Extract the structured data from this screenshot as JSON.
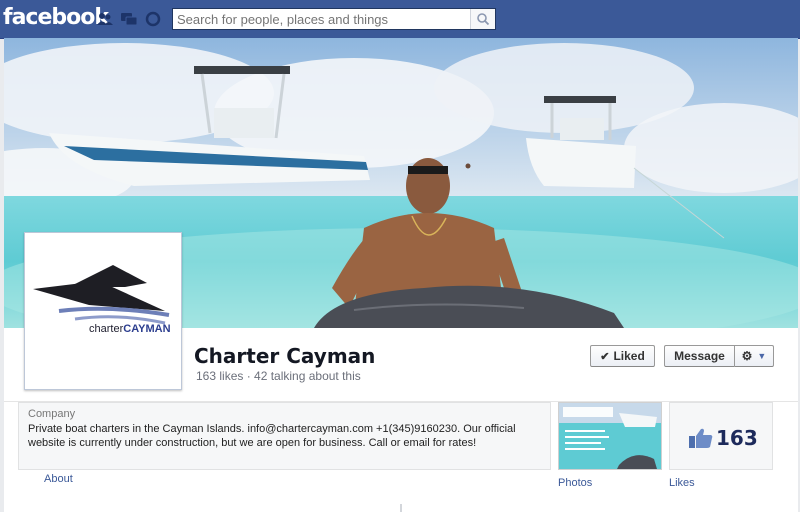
{
  "topbar": {
    "logo": "facebook",
    "search_placeholder": "Search for people, places and things",
    "icons": [
      "friends-icon",
      "messages-icon",
      "notifications-icon",
      "search-icon"
    ]
  },
  "profile": {
    "logo_text_prefix": "charter",
    "logo_text_suffix": "CAYMAN",
    "name": "Charter Cayman",
    "stats": "163 likes · 42 talking about this"
  },
  "actions": {
    "liked_label": "Liked",
    "message_label": "Message"
  },
  "about": {
    "category": "Company",
    "description": "Private boat charters in the Cayman Islands. info@chartercayman.com +1(345)9160230. Our official website is currently under construction, but we are open for business. Call or email for rates!",
    "about_link": "About"
  },
  "apps": {
    "photos_label": "Photos",
    "likes_count": "163",
    "likes_label": "Likes"
  },
  "colors": {
    "brand_blue": "#3b5998",
    "water": "#6fd3d8",
    "sky": "#a9c8e6"
  }
}
